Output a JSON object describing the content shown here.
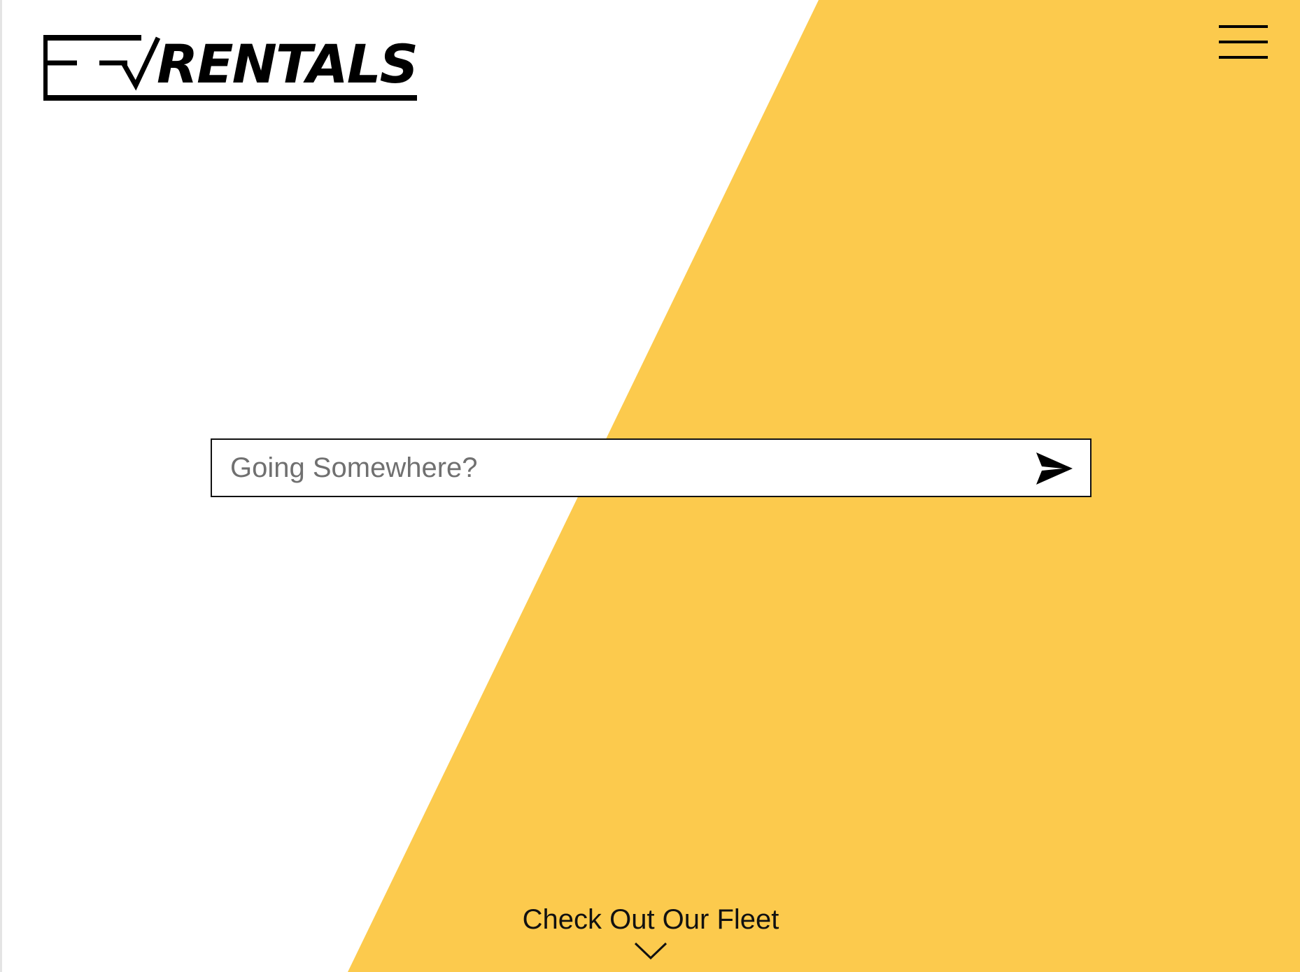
{
  "brand": {
    "logo_text": "EVRENTALS",
    "accent_color": "#FCCA4D",
    "ink_color": "#000000"
  },
  "header": {
    "menu_icon": "hamburger-menu-icon"
  },
  "search": {
    "placeholder": "Going Somewhere?",
    "value": "",
    "submit_icon": "paper-plane-send-icon"
  },
  "fleet": {
    "label": "Check Out Our Fleet",
    "icon": "chevron-down-icon"
  }
}
